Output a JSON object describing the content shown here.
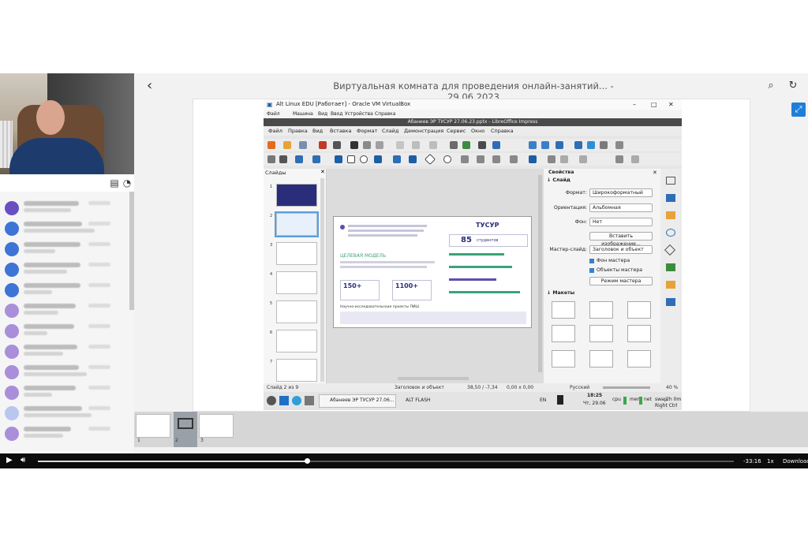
{
  "header": {
    "title": "Виртуальная комната для проведения онлайн-занятий... - 29.06.2023"
  },
  "vbox": {
    "window_title": "Alt Linux EDU [Работает] - Oracle VM VirtualBox",
    "menu": [
      "Файл",
      "Машина",
      "Вид",
      "Ввод",
      "Устройства",
      "Справка"
    ]
  },
  "impress": {
    "doc_title": "Абанеев ЭР ТУСУР 27.06.23.pptx - LibreOffice Impress",
    "menu": [
      "Файл",
      "Правка",
      "Вид",
      "Вставка",
      "Формат",
      "Слайд",
      "Демонстрация",
      "Сервис",
      "Окно",
      "Справка"
    ],
    "slides_panel_title": "Слайды",
    "slide_numbers": [
      "1",
      "2",
      "3",
      "4",
      "5",
      "6",
      "7"
    ]
  },
  "properties": {
    "title": "Свойства",
    "section_slide": "Слайд",
    "format_label": "Формат:",
    "format_value": "Широкоформатный",
    "orientation_label": "Ориентация:",
    "orientation_value": "Альбомная",
    "background_label": "Фон:",
    "background_value": "Нет",
    "insert_image": "Вставить изображение...",
    "master_label": "Мастер-слайд:",
    "master_value": "Заголовок и объект",
    "bg_master": "Фон мастера",
    "objects_master": "Объекты мастера",
    "master_mode": "Режим мастера",
    "section_layouts": "Макеты"
  },
  "slide_content": {
    "brand": "ТУСУР",
    "students_number": "85",
    "students_label": "студентов",
    "section": "ЦЕЛЕВАЯ МОДЕЛЬ",
    "stat1": "150+",
    "stat2": "1100+",
    "footer": "Научно-исследовательские проекты ПИШ"
  },
  "statusbar": {
    "slide": "Слайд 2 из 9",
    "layout": "Заголовок и объект",
    "pos": "38,50 / -7,34",
    "size": "0,00 x 0,00",
    "lang": "Русский",
    "zoom": "40 %"
  },
  "taskbar": {
    "task1": "Абанеев ЭР ТУСУР 27.06...",
    "task2": "ALT FLASH",
    "lang": "EN",
    "time": "18:25",
    "date": "Чт, 29.06",
    "indicators": [
      "cpu",
      "mem",
      "net",
      "swap"
    ],
    "uptime": "2h 0m",
    "host_key": "Right Ctrl"
  },
  "filmstrip": [
    "1",
    "2",
    "3"
  ],
  "player": {
    "remaining": "-33:16",
    "speed": "1x",
    "download": "Download",
    "progress": 0.387
  }
}
